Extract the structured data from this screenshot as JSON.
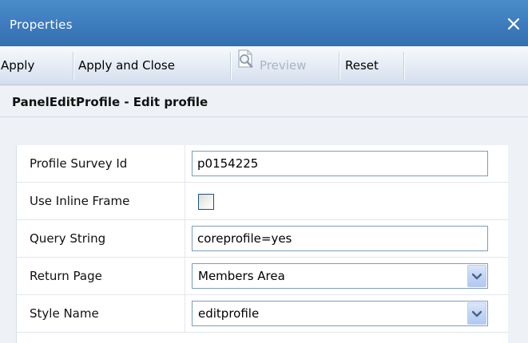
{
  "window": {
    "title": "Properties",
    "close_icon": "close-icon"
  },
  "toolbar": {
    "apply_label": "Apply",
    "apply_close_label": "Apply and Close",
    "preview_label": "Preview",
    "preview_icon": "magnifier-page-icon",
    "preview_enabled": false,
    "reset_label": "Reset"
  },
  "panel": {
    "heading": "PanelEditProfile - Edit profile"
  },
  "properties": {
    "profile_survey_id": {
      "label": "Profile Survey Id",
      "value": "p0154225"
    },
    "use_inline_frame": {
      "label": "Use Inline Frame",
      "checked": false
    },
    "query_string": {
      "label": "Query String",
      "value": "coreprofile=yes"
    },
    "return_page": {
      "label": "Return Page",
      "selected": "Members Area"
    },
    "style_name": {
      "label": "Style Name",
      "selected": "editprofile"
    }
  },
  "colors": {
    "titlebar": "#3d7bbd",
    "toolbar": "#e4ebf5",
    "panel_background": "#eef1f6",
    "disabled_text": "#a9b3c2"
  }
}
